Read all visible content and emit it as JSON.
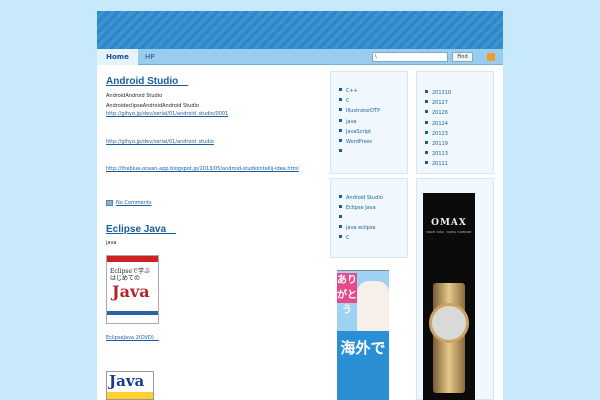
{
  "nav": {
    "home": "Home",
    "hp": "HP"
  },
  "search": {
    "value": "\\",
    "button": "Find"
  },
  "posts": [
    {
      "title": "Android Studio　",
      "lines": [
        "AndroidAndroid Studio",
        "AndroideclipseAndroidAndroid Studio"
      ],
      "links": [
        "http://gihyo.jp/dev/serial/01/android_studio/0001",
        "http://gihyo.jp/dev/serial/01/android_studio",
        "http://theblue-ocean-app.blogspot.jp/2013/05/android-studiointellij-idea.html"
      ],
      "comments": "No Comments"
    },
    {
      "title": "Eclipse Java　",
      "text": "java",
      "book_link": "EclipseJava 2(DVD)　",
      "book1": {
        "jp": "Eclipseで学ぶ",
        "jp2": "はじめての",
        "java": "Java"
      },
      "book2": {
        "java": "Java"
      }
    }
  ],
  "categories": [
    "C++",
    "C",
    "IllustratorDTP",
    "java",
    "JavaScript",
    "WordPress",
    ""
  ],
  "archives": [
    "201310",
    "20127",
    "20126",
    "20124",
    "20123",
    "20119",
    "20113",
    "20111"
  ],
  "recent": [
    "Android Studio",
    "Eclipse Java",
    "",
    "java eclipse",
    "C"
  ],
  "ads": {
    "left": {
      "pink": "ありがとう",
      "blue": "海外で"
    },
    "right": {
      "brand": "OMAX",
      "sub": "SINCE 1969 · SWISS COMPANY"
    }
  },
  "colors": {
    "banner": "#2e86c8",
    "nav": "#99cdf0",
    "link": "#1a5d9c",
    "background": "#c7e9f9"
  }
}
